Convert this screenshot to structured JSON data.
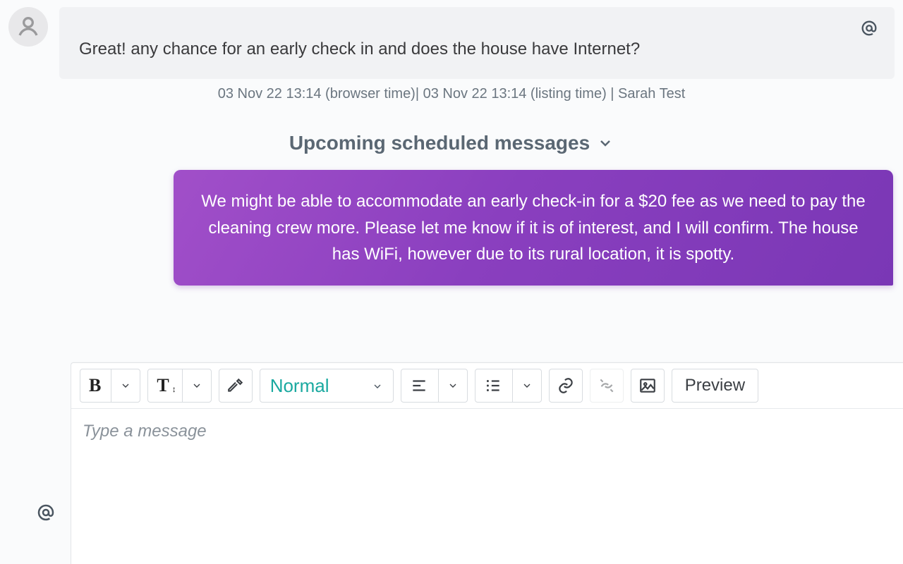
{
  "incoming": {
    "text": "Great! any chance for an early check in and does the house have Internet?",
    "meta": "03 Nov 22 13:14 (browser time)| 03 Nov 22 13:14 (listing time) | Sarah Test"
  },
  "section": {
    "title": "Upcoming scheduled messages"
  },
  "outgoing": {
    "text": "We might be able to accommodate an early check-in for a $20 fee as we need to pay the cleaning crew more. Please let me know if it is of interest, and I will confirm. The house has WiFi, however due to its rural location, it is spotty."
  },
  "toolbar": {
    "format_label": "Normal",
    "preview_label": "Preview"
  },
  "composer": {
    "placeholder": "Type a message"
  }
}
